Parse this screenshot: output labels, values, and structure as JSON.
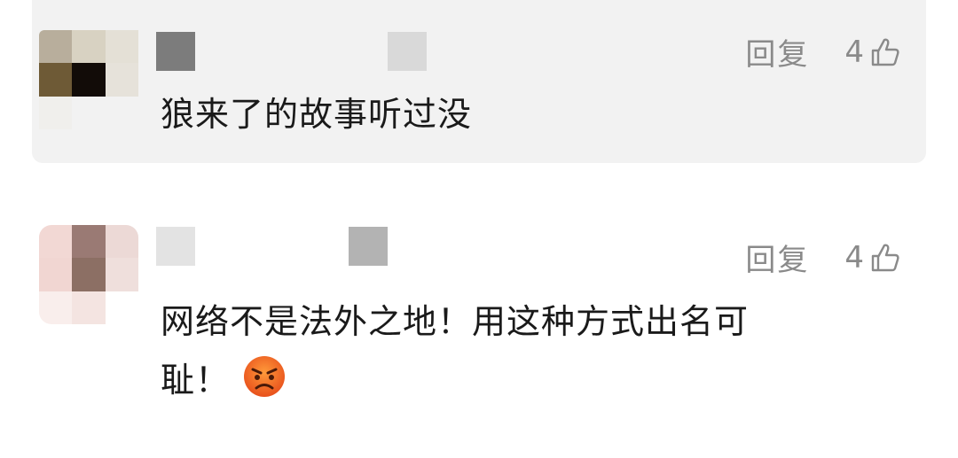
{
  "comments": [
    {
      "reply_label": "回复",
      "likes": "4",
      "text": "狼来了的故事听过没"
    },
    {
      "reply_label": "回复",
      "likes": "4",
      "text_line1": "网络不是法外之地！用这种方式出名可",
      "text_line2": "耻！",
      "emoji": "angry-face"
    }
  ],
  "colors": {
    "card_background": "#f2f2f2",
    "text": "#1a1a1a",
    "meta": "#8a8a8a"
  }
}
